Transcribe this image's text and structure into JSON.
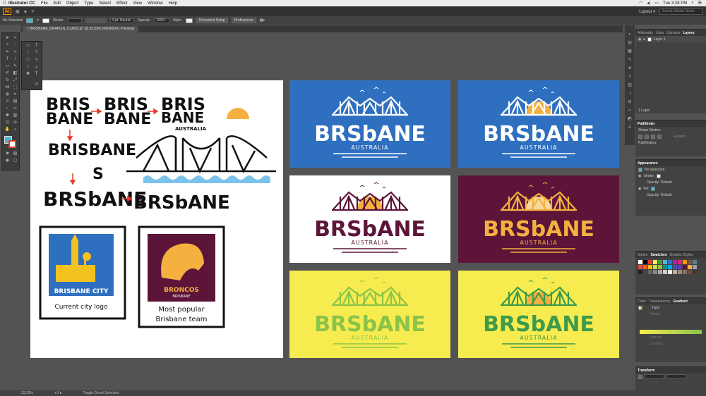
{
  "menubar": {
    "apple": "",
    "app": "Illustrator CC",
    "items": [
      "File",
      "Edit",
      "Object",
      "Type",
      "Select",
      "Effect",
      "View",
      "Window",
      "Help"
    ],
    "clock": "Tue 3:28 PM"
  },
  "appbar": {
    "logo": "Ai",
    "layout": "Layout ▾",
    "search_placeholder": "Search Adobe Stock"
  },
  "control": {
    "selection": "No Selection",
    "stroke_label": "Stroke:",
    "brush": "3 pt. Round",
    "opacity_label": "Opacity:",
    "opacity_value": "100%",
    "style_label": "Style:",
    "doc_setup": "Document Setup",
    "preferences": "Preferences"
  },
  "document": {
    "tab": "BRISBANE_DRAPLIN_CLASS.ai* @ 33.33% (RGB/GPU Preview)"
  },
  "status": {
    "zoom": "33.33%",
    "page": "1",
    "tool": "Toggle Direct Selection"
  },
  "panels": {
    "layers_tabs": [
      "Artboards",
      "Links",
      "Libraries",
      "Layers"
    ],
    "layer_name": "Layer 1",
    "layers_count": "1 Layer",
    "pathfinder_title": "Pathfinder",
    "shape_modes": "Shape Modes:",
    "pathfinders": "Pathfinders:",
    "expand": "Expand",
    "appearance_title": "Appearance",
    "appearance_sel": "No Selection",
    "app_stroke": "Stroke:",
    "app_fill": "Fill:",
    "app_opacity": "Opacity: Default",
    "swatch_tabs": [
      "Stroke",
      "Swatches",
      "Graphic Styles"
    ],
    "gradient_tabs": [
      "Color",
      "Transparency",
      "Gradient"
    ],
    "grad_type": "Type:",
    "grad_stroke": "Stroke:",
    "grad_opacity": "Opacity:",
    "grad_location": "Location:",
    "transform_title": "Transform"
  },
  "artwork": {
    "sketch_words": [
      "BRIS",
      "BANE",
      "BRIS",
      "BANE",
      "BRIS",
      "BANE",
      "AUSTRALIA",
      "BRISBANE",
      "S",
      "BRSbANE",
      "BRSbANE"
    ],
    "city_logo_text": "BRISBANE CITY",
    "city_caption": "Current city logo",
    "broncos_text": "BRONCOS",
    "broncos_sub": "BRISBANE",
    "broncos_caption_1": "Most popular",
    "broncos_caption_2": "Brisbane team",
    "wordmark": "BRSbANE",
    "sub": "AUSTRALIA"
  },
  "colors": {
    "blue": "#2f6fbf",
    "maroon": "#5c1538",
    "yellow": "#f7ec4f",
    "orange": "#f4b13f",
    "green_light": "#8bc34a",
    "green_dark": "#3f9a4b",
    "red_arrow": "#e53b2c"
  }
}
